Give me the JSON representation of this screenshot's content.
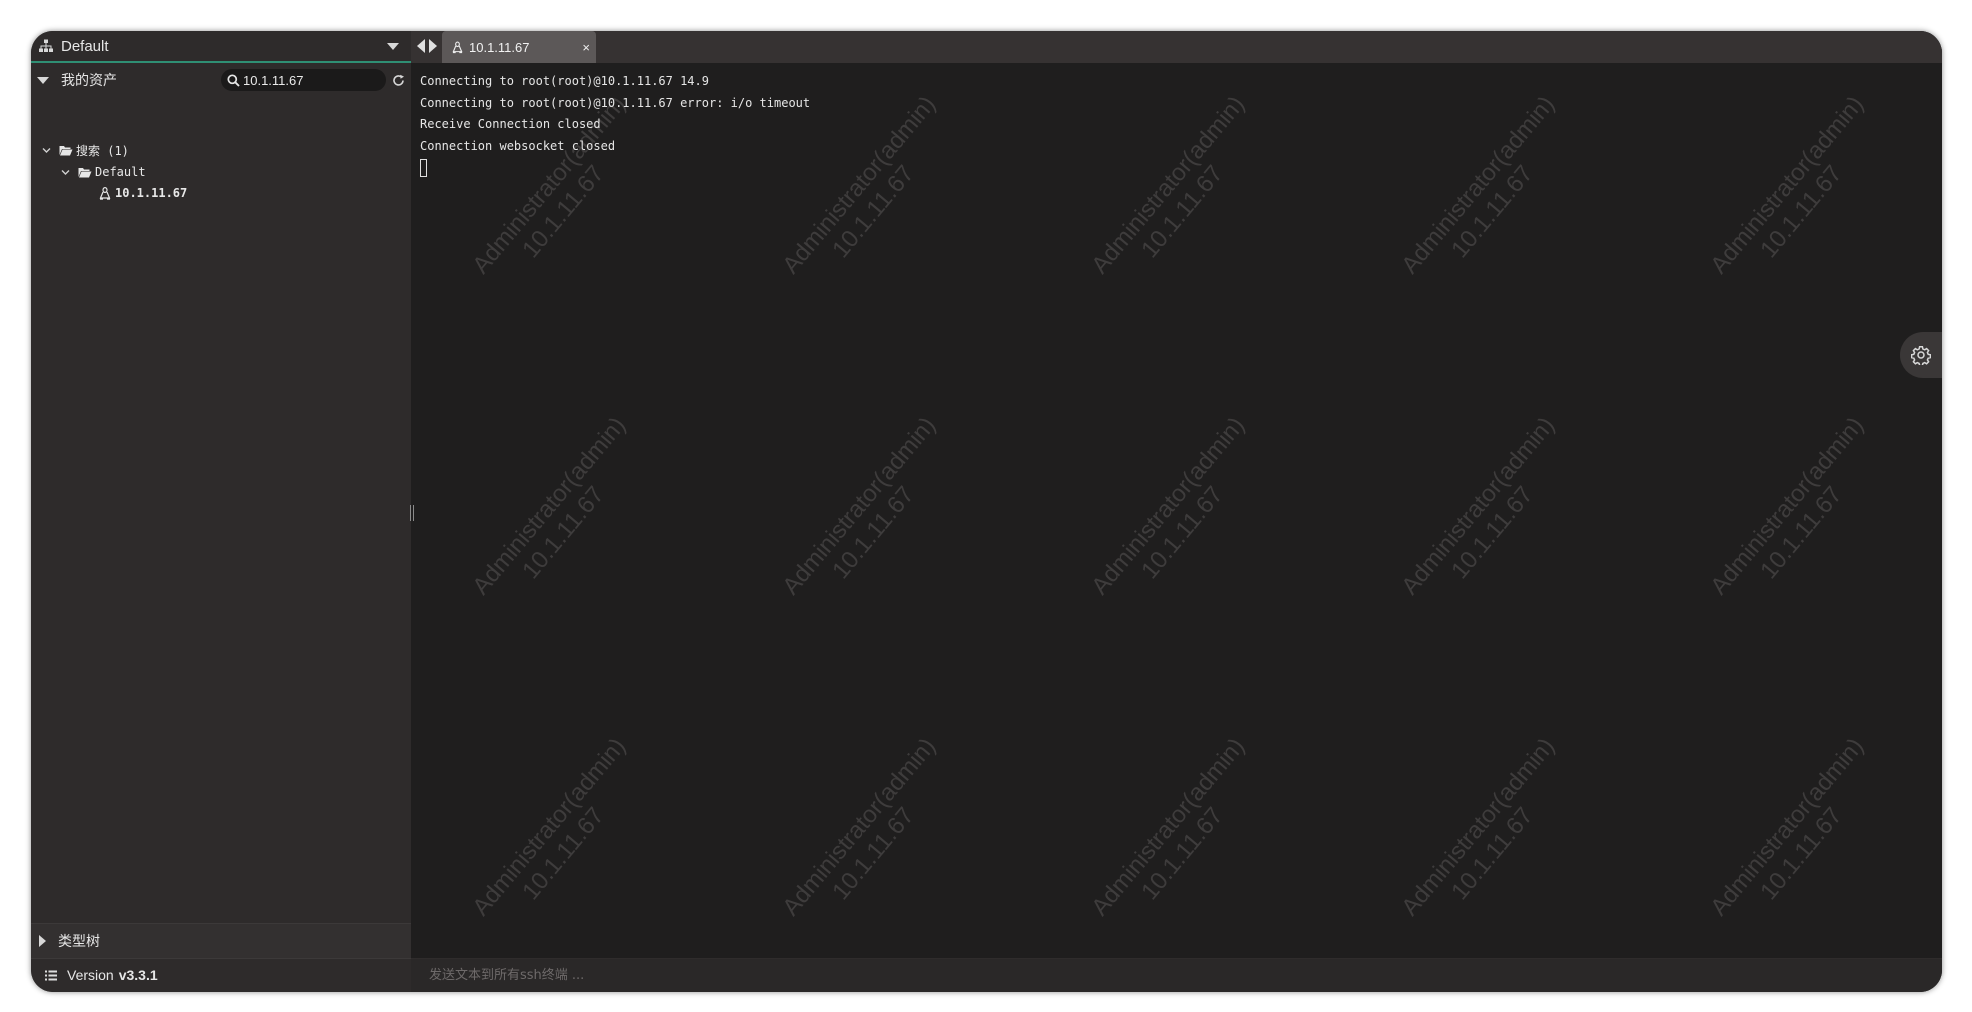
{
  "sidebar": {
    "org_name": "Default",
    "assets_title": "我的资产",
    "search": {
      "value": "10.1.11.67"
    },
    "tree": {
      "search_node": "搜索 (1)",
      "default_node": "Default",
      "host_node": "10.1.11.67"
    },
    "types_tree_label": "类型树",
    "version_label": "Version",
    "version_number": "v3.3.1"
  },
  "tabs": [
    {
      "label": "10.1.11.67",
      "close": "×"
    }
  ],
  "terminal": {
    "lines": [
      "Connecting to root(root)@10.1.11.67 14.9",
      "Connecting to root(root)@10.1.11.67 error: i/o timeout",
      "Receive Connection closed",
      "Connection websocket closed"
    ],
    "watermark": {
      "line1": "Administrator(admin)",
      "line2": "10.1.11.67"
    }
  },
  "send_bar": {
    "placeholder": "发送文本到所有ssh终端 ..."
  },
  "icons": {
    "org": "sitemap-icon",
    "search": "search-icon",
    "refresh": "refresh-icon",
    "folder": "folder-open-icon",
    "linux": "linux-icon",
    "settings": "gear-icon",
    "version": "list-icon"
  },
  "colors": {
    "accent": "#2f8f74",
    "terminal_bg": "#1f1e1e",
    "sidebar_bg": "#2e2b2b",
    "active_tab_bg": "#5c5858"
  }
}
